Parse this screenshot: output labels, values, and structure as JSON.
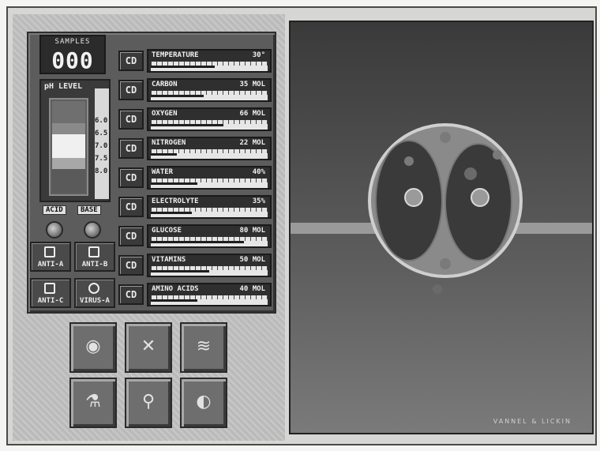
{
  "counter": {
    "label": "SAMPLES",
    "value": "000"
  },
  "ph": {
    "title": "pH LEVEL",
    "ticks": [
      "6.0",
      "6.5",
      "7.0",
      "7.5",
      "8.0"
    ],
    "acid_label": "ACID",
    "base_label": "BASE"
  },
  "antibodies": [
    {
      "label": "ANTI-A"
    },
    {
      "label": "ANTI-B"
    },
    {
      "label": "ANTI-C"
    },
    {
      "label": "VIRUS-A"
    }
  ],
  "readouts": [
    {
      "btn": "CD",
      "name": "TEMPERATURE",
      "value": "30°",
      "level": 0.55
    },
    {
      "btn": "CD",
      "name": "CARBON",
      "value": "35 MOL",
      "level": 0.45
    },
    {
      "btn": "CD",
      "name": "OXYGEN",
      "value": "66 MOL",
      "level": 0.62
    },
    {
      "btn": "CD",
      "name": "NITROGEN",
      "value": "22 MOL",
      "level": 0.22
    },
    {
      "btn": "CD",
      "name": "WATER",
      "value": "40%",
      "level": 0.4
    },
    {
      "btn": "CD",
      "name": "ELECTROLYTE",
      "value": "35%",
      "level": 0.35
    },
    {
      "btn": "CD",
      "name": "GLUCOSE",
      "value": "80 MOL",
      "level": 0.8
    },
    {
      "btn": "CD",
      "name": "VITAMINS",
      "value": "50 MOL",
      "level": 0.5
    },
    {
      "btn": "CD",
      "name": "AMINO ACIDS",
      "value": "40 MOL",
      "level": 0.4
    }
  ],
  "tools": [
    {
      "icon": "cell-icon",
      "glyph": "◉"
    },
    {
      "icon": "chromosome-icon",
      "glyph": "✕"
    },
    {
      "icon": "dna-icon",
      "glyph": "≋"
    },
    {
      "icon": "flask-icon",
      "glyph": "⚗"
    },
    {
      "icon": "microscope-icon",
      "glyph": "⚲"
    },
    {
      "icon": "disk-icon",
      "glyph": "◐"
    }
  ],
  "viewer": {
    "credit": "VANNEL & LICKIN"
  },
  "colors": {
    "panel": "#5c5c5c",
    "viewer": "#4c4c4c",
    "band": "#9a9a9a"
  }
}
